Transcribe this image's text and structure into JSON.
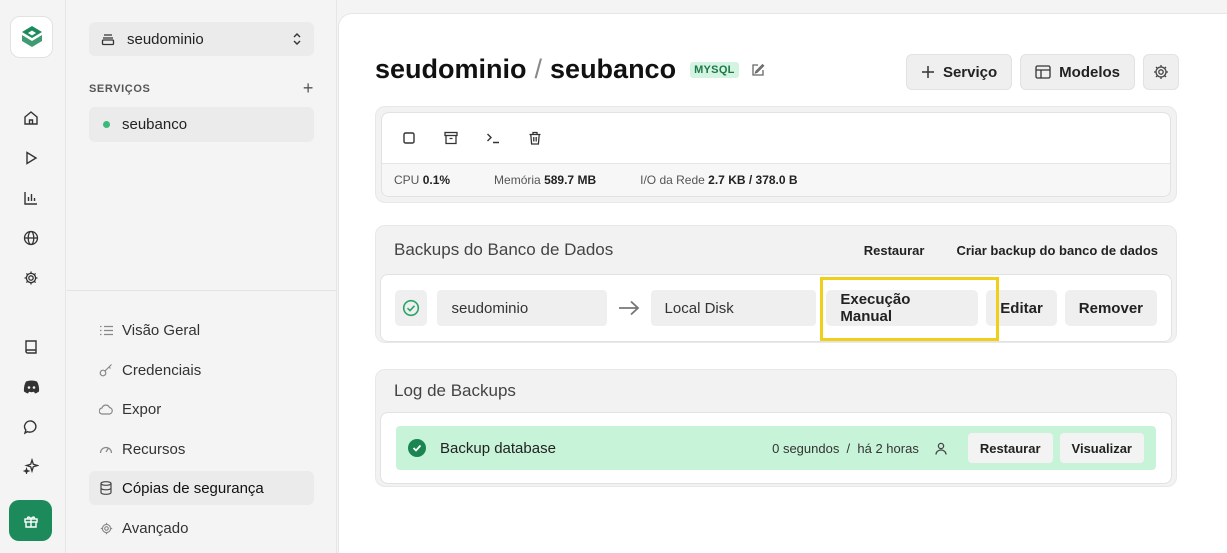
{
  "rail": {
    "icons": [
      "home-icon",
      "play-icon",
      "chart-icon",
      "globe-icon",
      "settings-icon",
      "book-icon",
      "discord-icon",
      "chat-icon",
      "sparkle-icon",
      "gift-icon"
    ],
    "accent": "#1d8a5c"
  },
  "sidebar": {
    "project": "seudominio",
    "services_label": "SERVIÇOS",
    "add_symbol": "+",
    "services": [
      {
        "name": "seubanco",
        "status_color": "#3cb878"
      }
    ],
    "nav": [
      {
        "label": "Visão Geral",
        "icon": "list-icon"
      },
      {
        "label": "Credenciais",
        "icon": "key-icon"
      },
      {
        "label": "Expor",
        "icon": "cloud-icon"
      },
      {
        "label": "Recursos",
        "icon": "gauge-icon"
      },
      {
        "label": "Cópias de segurança",
        "icon": "database-icon",
        "active": true
      },
      {
        "label": "Avançado",
        "icon": "gear-icon"
      }
    ]
  },
  "header": {
    "project": "seudominio",
    "separator": "/",
    "service": "seubanco",
    "badge": "MYSQL",
    "buttons": {
      "service": "Serviço",
      "models": "Modelos"
    }
  },
  "container": {
    "actions": [
      "stop-icon",
      "archive-icon",
      "terminal-icon",
      "trash-icon"
    ],
    "stats": {
      "cpu_label": "CPU",
      "cpu_value": "0.1%",
      "memory_label": "Memória",
      "memory_value": "589.7 MB",
      "network_label": "I/O da Rede",
      "network_value": "2.7 KB / 378.0 B"
    }
  },
  "backups": {
    "title": "Backups do Banco de Dados",
    "restore_link": "Restaurar",
    "create_link": "Criar backup do banco de dados",
    "source": "seudominio",
    "destination": "Local Disk",
    "buttons": {
      "manual": "Execução Manual",
      "edit": "Editar",
      "remove": "Remover"
    },
    "highlight_color": "#f0cf1a"
  },
  "log": {
    "title": "Log de Backups",
    "entries": [
      {
        "name": "Backup database",
        "meta": "0 segundos  /  há 2 horas",
        "restore": "Restaurar",
        "view": "Visualizar"
      }
    ]
  }
}
